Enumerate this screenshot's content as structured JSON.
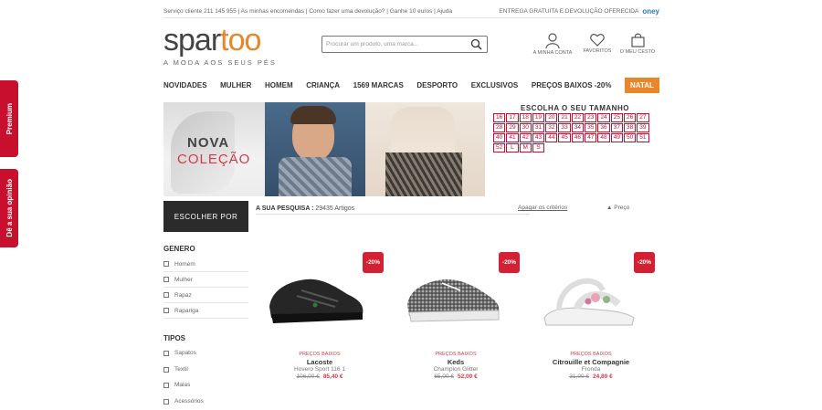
{
  "side_tabs": {
    "premium": "Premium",
    "opinion": "Dê a sua opinião"
  },
  "topbar": {
    "left": "Serviço cliente 211 145 955 | As minhas encomendas | Como fazer uma devolução? | Ganhe 10 euros | Ajuda",
    "right": "ENTREGA GRATUITA E DEVOLUÇÃO OFERECIDA",
    "partner": "oney"
  },
  "header": {
    "logo_part1": "spar",
    "logo_part2": "too",
    "tagline": "A MODA AOS SEUS PÉS",
    "search_placeholder": "Procurar um produto, uma marca...",
    "account_label": "A MINHA CONTA",
    "favorites_label": "FAVORITOS",
    "cart_label": "O MEU CESTO"
  },
  "nav": [
    "NOVIDADES",
    "MULHER",
    "HOMEM",
    "CRIANÇA",
    "1569 MARCAS",
    "DESPORTO",
    "EXCLUSIVOS",
    "PREÇOS BAIXOS -20%",
    "NATAL"
  ],
  "banner": {
    "line1": "NOVA",
    "line2": "COLEÇÃO"
  },
  "sizes": {
    "title": "ESCOLHA O SEU TAMANHO",
    "values": [
      "16",
      "17",
      "18",
      "19",
      "20",
      "21",
      "22",
      "23",
      "24",
      "25",
      "26",
      "27",
      "28",
      "29",
      "30",
      "31",
      "32",
      "33",
      "34",
      "35",
      "36",
      "37",
      "38",
      "39",
      "40",
      "41",
      "42",
      "43",
      "44",
      "45",
      "46",
      "47",
      "48",
      "49",
      "50",
      "51",
      "52",
      "L",
      "M",
      "S"
    ]
  },
  "filters": {
    "button": "ESCOLHER POR",
    "genero_title": "GENERO",
    "genero": [
      "Homem",
      "Mulher",
      "Rapaz",
      "Rapariga"
    ],
    "tipos_title": "TIPOS",
    "tipos": [
      "Sapatos",
      "Textil",
      "Malas",
      "Acessórios"
    ]
  },
  "results": {
    "label": "A SUA PESQUISA :",
    "count": "29435 Artigos",
    "clear": "Apagar os critérios",
    "sort": "Preço"
  },
  "products": [
    {
      "badge": "-20%",
      "label": "PREÇOS BAIXOS",
      "brand": "Lacoste",
      "model": "Hovero Sport 116 1",
      "old_price": "106,00 €",
      "new_price": "85,40 €"
    },
    {
      "badge": "-20%",
      "label": "PREÇOS BAIXOS",
      "brand": "Keds",
      "model": "Champion Glitter",
      "old_price": "65,00 €",
      "new_price": "52,00 €"
    },
    {
      "badge": "-20%",
      "label": "PREÇOS BAIXOS",
      "brand": "Citrouille et Compagnie",
      "model": "Fronda",
      "old_price": "31,00 €",
      "new_price": "24,80 €"
    }
  ],
  "colors": {
    "brand_red": "#c8102e",
    "brand_orange": "#e8862a"
  }
}
